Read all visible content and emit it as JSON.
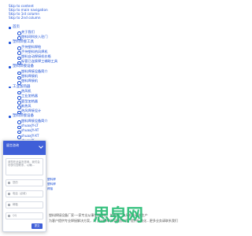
{
  "skip_links": [
    "Skip to content",
    "Skip to main navigation",
    "Skip to 1st column",
    "Skip to 2nd column"
  ],
  "nav": [
    {
      "label": "首页",
      "items": [
        "关于我们",
        "塑料网科技入驻门"
      ]
    },
    {
      "label": "塑料焊接工具",
      "items": [
        "手持塑料焊枪",
        "手持塑料热风焊机",
        "塑料自动焊接机价格",
        "标管已连接焊工辅助工具"
      ]
    },
    {
      "label": "塑料焊接设备",
      "items": [
        "塑料焊接设备简介",
        "塑料焊接机",
        "塑料焊接机"
      ]
    },
    {
      "label": "工业加热器",
      "items": [
        "热风机",
        "工业加热器",
        "管型加热器",
        "新热风",
        "热风焊接设计"
      ]
    },
    {
      "label": "塑料焊接设备",
      "items": [
        "塑料焊接设备简介",
        "shuaxJY-LT",
        "shuaxJY-AT",
        "shuaxJY-XT",
        "shuaxJY"
      ]
    }
  ],
  "background": {
    "fragments": [
      "塑料焊",
      "塑料焊",
      "焊接"
    ],
    "banner_line1": "塑料焊接设备厂家-一家专业从事塑料焊机、加热机、热风机的研发生产",
    "banner_line2": "为客户提供专业焊接解决方案，为了让塑料焊机更加好用，提供标准化...更多业务请联系我们"
  },
  "watermark": "思泉网",
  "chat": {
    "title": "留言咨询",
    "message_placeholder": "请您在此留言咨询，我们会尽快与您联系，以确...",
    "fields": [
      {
        "icon": "person-icon",
        "placeholder": "您的"
      },
      {
        "icon": "phone-icon",
        "placeholder": "电话（必填）"
      },
      {
        "icon": "mail-icon",
        "placeholder": "邮箱"
      },
      {
        "icon": "chat-icon",
        "placeholder": "QQ"
      }
    ],
    "send_label": "提交"
  }
}
